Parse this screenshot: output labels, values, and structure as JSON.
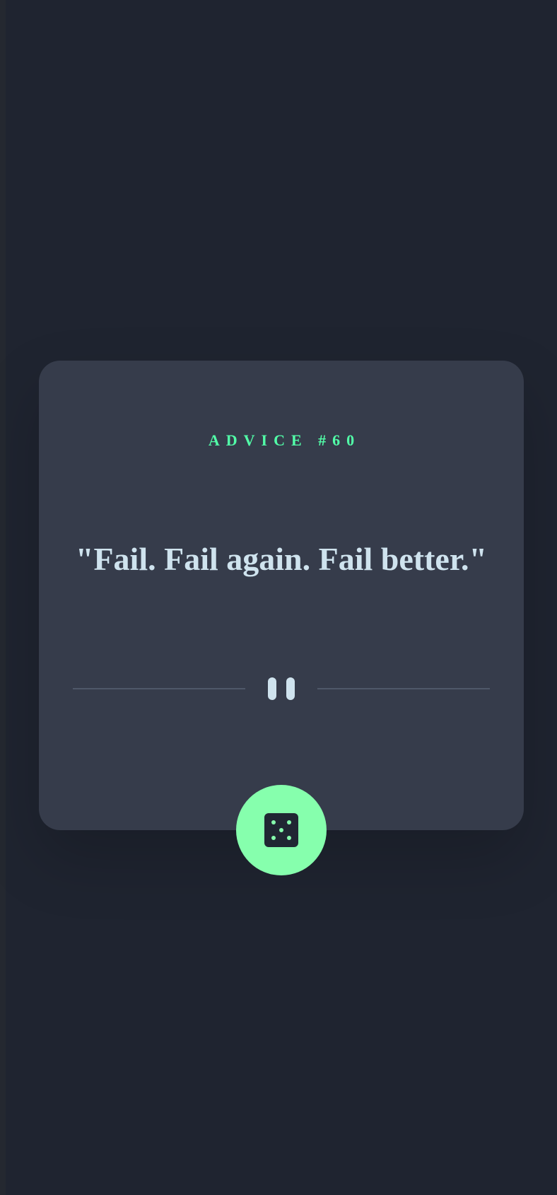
{
  "advice": {
    "label": "ADVICE #60",
    "quote": "\"Fail. Fail again. Fail better.\""
  },
  "divider": {
    "icon": "pause-icon"
  },
  "button": {
    "icon": "dice-icon"
  },
  "colors": {
    "background": "#1f2430",
    "card": "#363c4b",
    "accent": "#86ffad",
    "label": "#52ffa8",
    "text": "#cfe3ee",
    "divider_line": "#4f5869"
  }
}
